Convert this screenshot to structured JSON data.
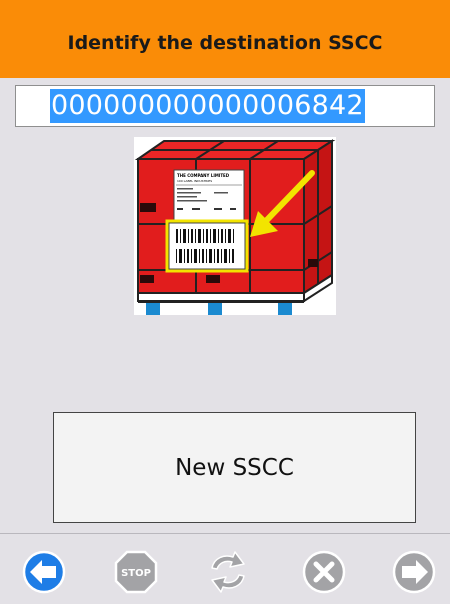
{
  "header": {
    "title": "Identify the destination SSCC"
  },
  "sscc_field": {
    "value": "000000000000006842",
    "selected": true
  },
  "illustration": {
    "icon": "pallet-label-icon",
    "label_lines": [
      "THE COMPANY LIMITED",
      "100 LABEL INDUSTRIES"
    ]
  },
  "new_sscc_button": {
    "label": "New SSCC"
  },
  "toolbar": {
    "back": {
      "icon": "back-arrow-icon",
      "enabled": true
    },
    "stop": {
      "icon": "stop-icon",
      "label": "STOP",
      "enabled": false
    },
    "refresh": {
      "icon": "refresh-icon",
      "enabled": false
    },
    "cancel": {
      "icon": "cancel-icon",
      "enabled": false
    },
    "next": {
      "icon": "next-arrow-icon",
      "enabled": false
    }
  },
  "colors": {
    "header_bg": "#fa8c07",
    "selection": "#3399ff",
    "back_button": "#1e7de6",
    "disabled_button": "#a3a3a6",
    "pallet_red": "#e11d1d",
    "highlight_yellow": "#f2e400"
  }
}
